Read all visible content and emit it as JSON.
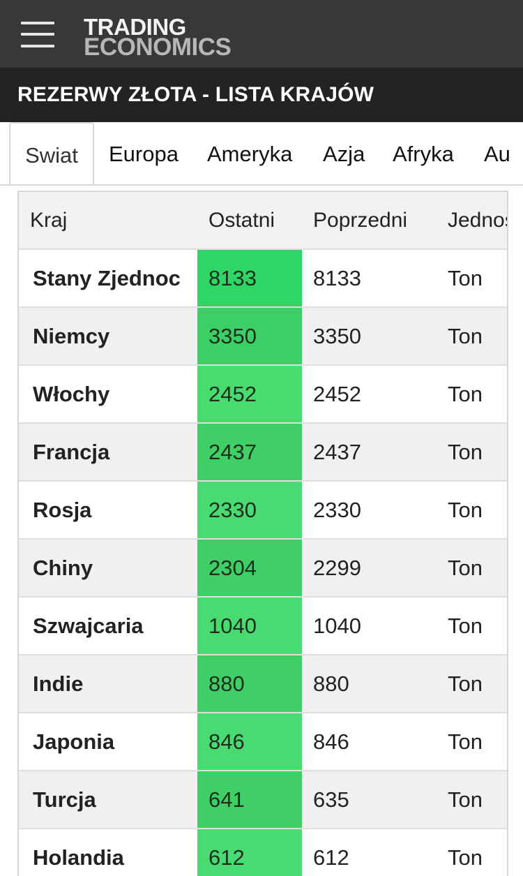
{
  "header": {
    "logo_line1": "TRADING",
    "logo_line2": "ECONOMICS",
    "menu_icon": "hamburger-menu-icon"
  },
  "page_title": "REZERWY ZŁOTA - LISTA KRAJÓW",
  "tabs": [
    {
      "label": "Swiat",
      "active": true
    },
    {
      "label": "Europa",
      "active": false
    },
    {
      "label": "Ameryka",
      "active": false
    },
    {
      "label": "Azja",
      "active": false
    },
    {
      "label": "Afryka",
      "active": false
    },
    {
      "label": "Au",
      "active": false
    }
  ],
  "table": {
    "columns": [
      "Kraj",
      "Ostatni",
      "Poprzedni",
      "Jednostk"
    ],
    "rows": [
      {
        "country": "Stany Zjednoc",
        "last": "8133",
        "previous": "8133",
        "unit": "Ton",
        "last_bg": "#2fd565"
      },
      {
        "country": "Niemcy",
        "last": "3350",
        "previous": "3350",
        "unit": "Ton",
        "last_bg": "#3ccf65"
      },
      {
        "country": "Włochy",
        "last": "2452",
        "previous": "2452",
        "unit": "Ton",
        "last_bg": "#47dc6f"
      },
      {
        "country": "Francja",
        "last": "2437",
        "previous": "2437",
        "unit": "Ton",
        "last_bg": "#40cf67"
      },
      {
        "country": "Rosja",
        "last": "2330",
        "previous": "2330",
        "unit": "Ton",
        "last_bg": "#4ada72"
      },
      {
        "country": "Chiny",
        "last": "2304",
        "previous": "2299",
        "unit": "Ton",
        "last_bg": "#40cf67"
      },
      {
        "country": "Szwajcaria",
        "last": "1040",
        "previous": "1040",
        "unit": "Ton",
        "last_bg": "#4ada72"
      },
      {
        "country": "Indie",
        "last": "880",
        "previous": "880",
        "unit": "Ton",
        "last_bg": "#40cf67"
      },
      {
        "country": "Japonia",
        "last": "846",
        "previous": "846",
        "unit": "Ton",
        "last_bg": "#4ada72"
      },
      {
        "country": "Turcja",
        "last": "641",
        "previous": "635",
        "unit": "Ton",
        "last_bg": "#40cf67"
      },
      {
        "country": "Holandia",
        "last": "612",
        "previous": "612",
        "unit": "Ton",
        "last_bg": "#4ada72"
      }
    ]
  }
}
